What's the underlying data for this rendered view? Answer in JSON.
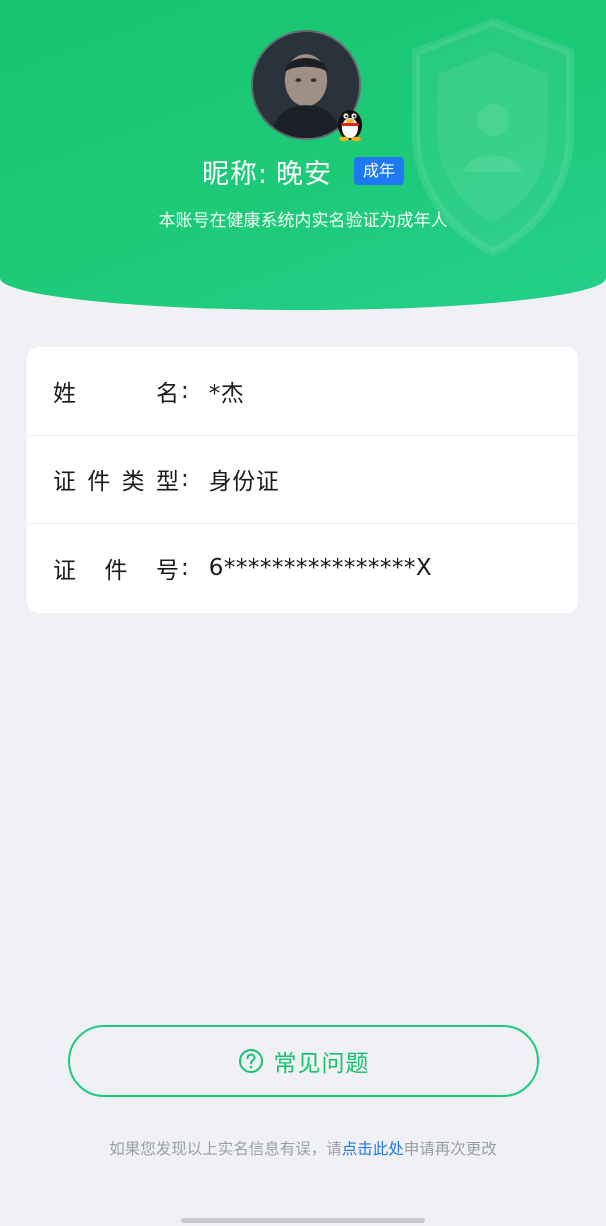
{
  "header": {
    "nickname_label": "昵称:",
    "nickname_value": "晚安",
    "adult_badge": "成年",
    "verify_text": "本账号在健康系统内实名验证为成年人"
  },
  "info": {
    "rows": [
      {
        "label_chars": [
          "姓",
          "名"
        ],
        "colon": ":",
        "value": "*杰"
      },
      {
        "label_chars": [
          "证",
          "件",
          "类",
          "型"
        ],
        "colon": ":",
        "value": "身份证"
      },
      {
        "label_chars": [
          "证",
          "件",
          "号"
        ],
        "colon": ":",
        "value": "6****************X"
      }
    ]
  },
  "faq": {
    "label": "常见问题",
    "icon": "question-circle-icon"
  },
  "footer": {
    "prefix": "如果您发现以上实名信息有误，请",
    "link": "点击此处",
    "suffix": "申请再次更改"
  },
  "colors": {
    "brand_green": "#1dca78",
    "badge_blue": "#1e7af2",
    "link_blue": "#1f77e6",
    "background": "#f0f1f5"
  }
}
